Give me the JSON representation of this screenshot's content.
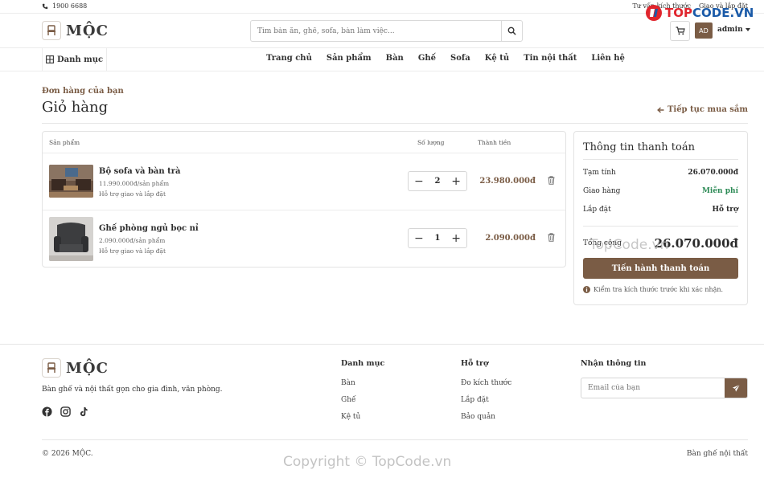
{
  "topbar": {
    "phone": "1900 6688",
    "link_size": "Tư vấn kích thước",
    "link_install": "Giao và lắp đặt"
  },
  "brand": {
    "name": "MỘC"
  },
  "search": {
    "placeholder": "Tìm bàn ăn, ghế, sofa, bàn làm việc..."
  },
  "user": {
    "initials": "AD",
    "name": "admin"
  },
  "nav": {
    "categories_label": "Danh mục",
    "items": [
      "Trang chủ",
      "Sản phẩm",
      "Bàn",
      "Ghế",
      "Sofa",
      "Kệ tủ",
      "Tin nội thất",
      "Liên hệ"
    ]
  },
  "page": {
    "breadcrumb": "Đơn hàng của bạn",
    "title": "Giỏ hàng",
    "continue": "Tiếp tục mua sắm"
  },
  "cart": {
    "headers": {
      "product": "Sản phẩm",
      "quantity": "Số lượng",
      "total": "Thành tiền"
    },
    "items": [
      {
        "name": "Bộ sofa và bàn trà",
        "unit_price": "11.990.000đ/sản phẩm",
        "note": "Hỗ trợ giao và lắp đặt",
        "qty": "2",
        "total": "23.980.000đ"
      },
      {
        "name": "Ghế phòng ngủ bọc nỉ",
        "unit_price": "2.090.000đ/sản phẩm",
        "note": "Hỗ trợ giao và lắp đặt",
        "qty": "1",
        "total": "2.090.000đ"
      }
    ]
  },
  "payment": {
    "title": "Thông tin thanh toán",
    "subtotal_label": "Tạm tính",
    "subtotal": "26.070.000đ",
    "shipping_label": "Giao hàng",
    "shipping": "Miễn phí",
    "install_label": "Lắp đặt",
    "install": "Hỗ trợ",
    "total_label": "Tổng cộng",
    "total": "26.070.000đ",
    "checkout": "Tiến hành thanh toán",
    "hint": "Kiểm tra kích thước trước khi xác nhận."
  },
  "footer": {
    "desc": "Bàn ghế và nội thất gọn cho gia đình, văn phòng.",
    "col1": {
      "title": "Danh mục",
      "items": [
        "Bàn",
        "Ghế",
        "Kệ tủ"
      ]
    },
    "col2": {
      "title": "Hỗ trợ",
      "items": [
        "Đo kích thước",
        "Lắp đặt",
        "Bảo quản"
      ]
    },
    "newsletter": {
      "title": "Nhận thông tin",
      "placeholder": "Email của bạn"
    },
    "copyright": "© 2026 MỘC.",
    "tagline": "Bàn ghế nội thất"
  },
  "watermark": {
    "text": "Copyright © TopCode.vn",
    "text2": "TopCode.vn",
    "logo_a": "TOP",
    "logo_b": "CODE.VN"
  },
  "colors": {
    "accent": "#7a5c45",
    "free": "#2e8b57"
  }
}
